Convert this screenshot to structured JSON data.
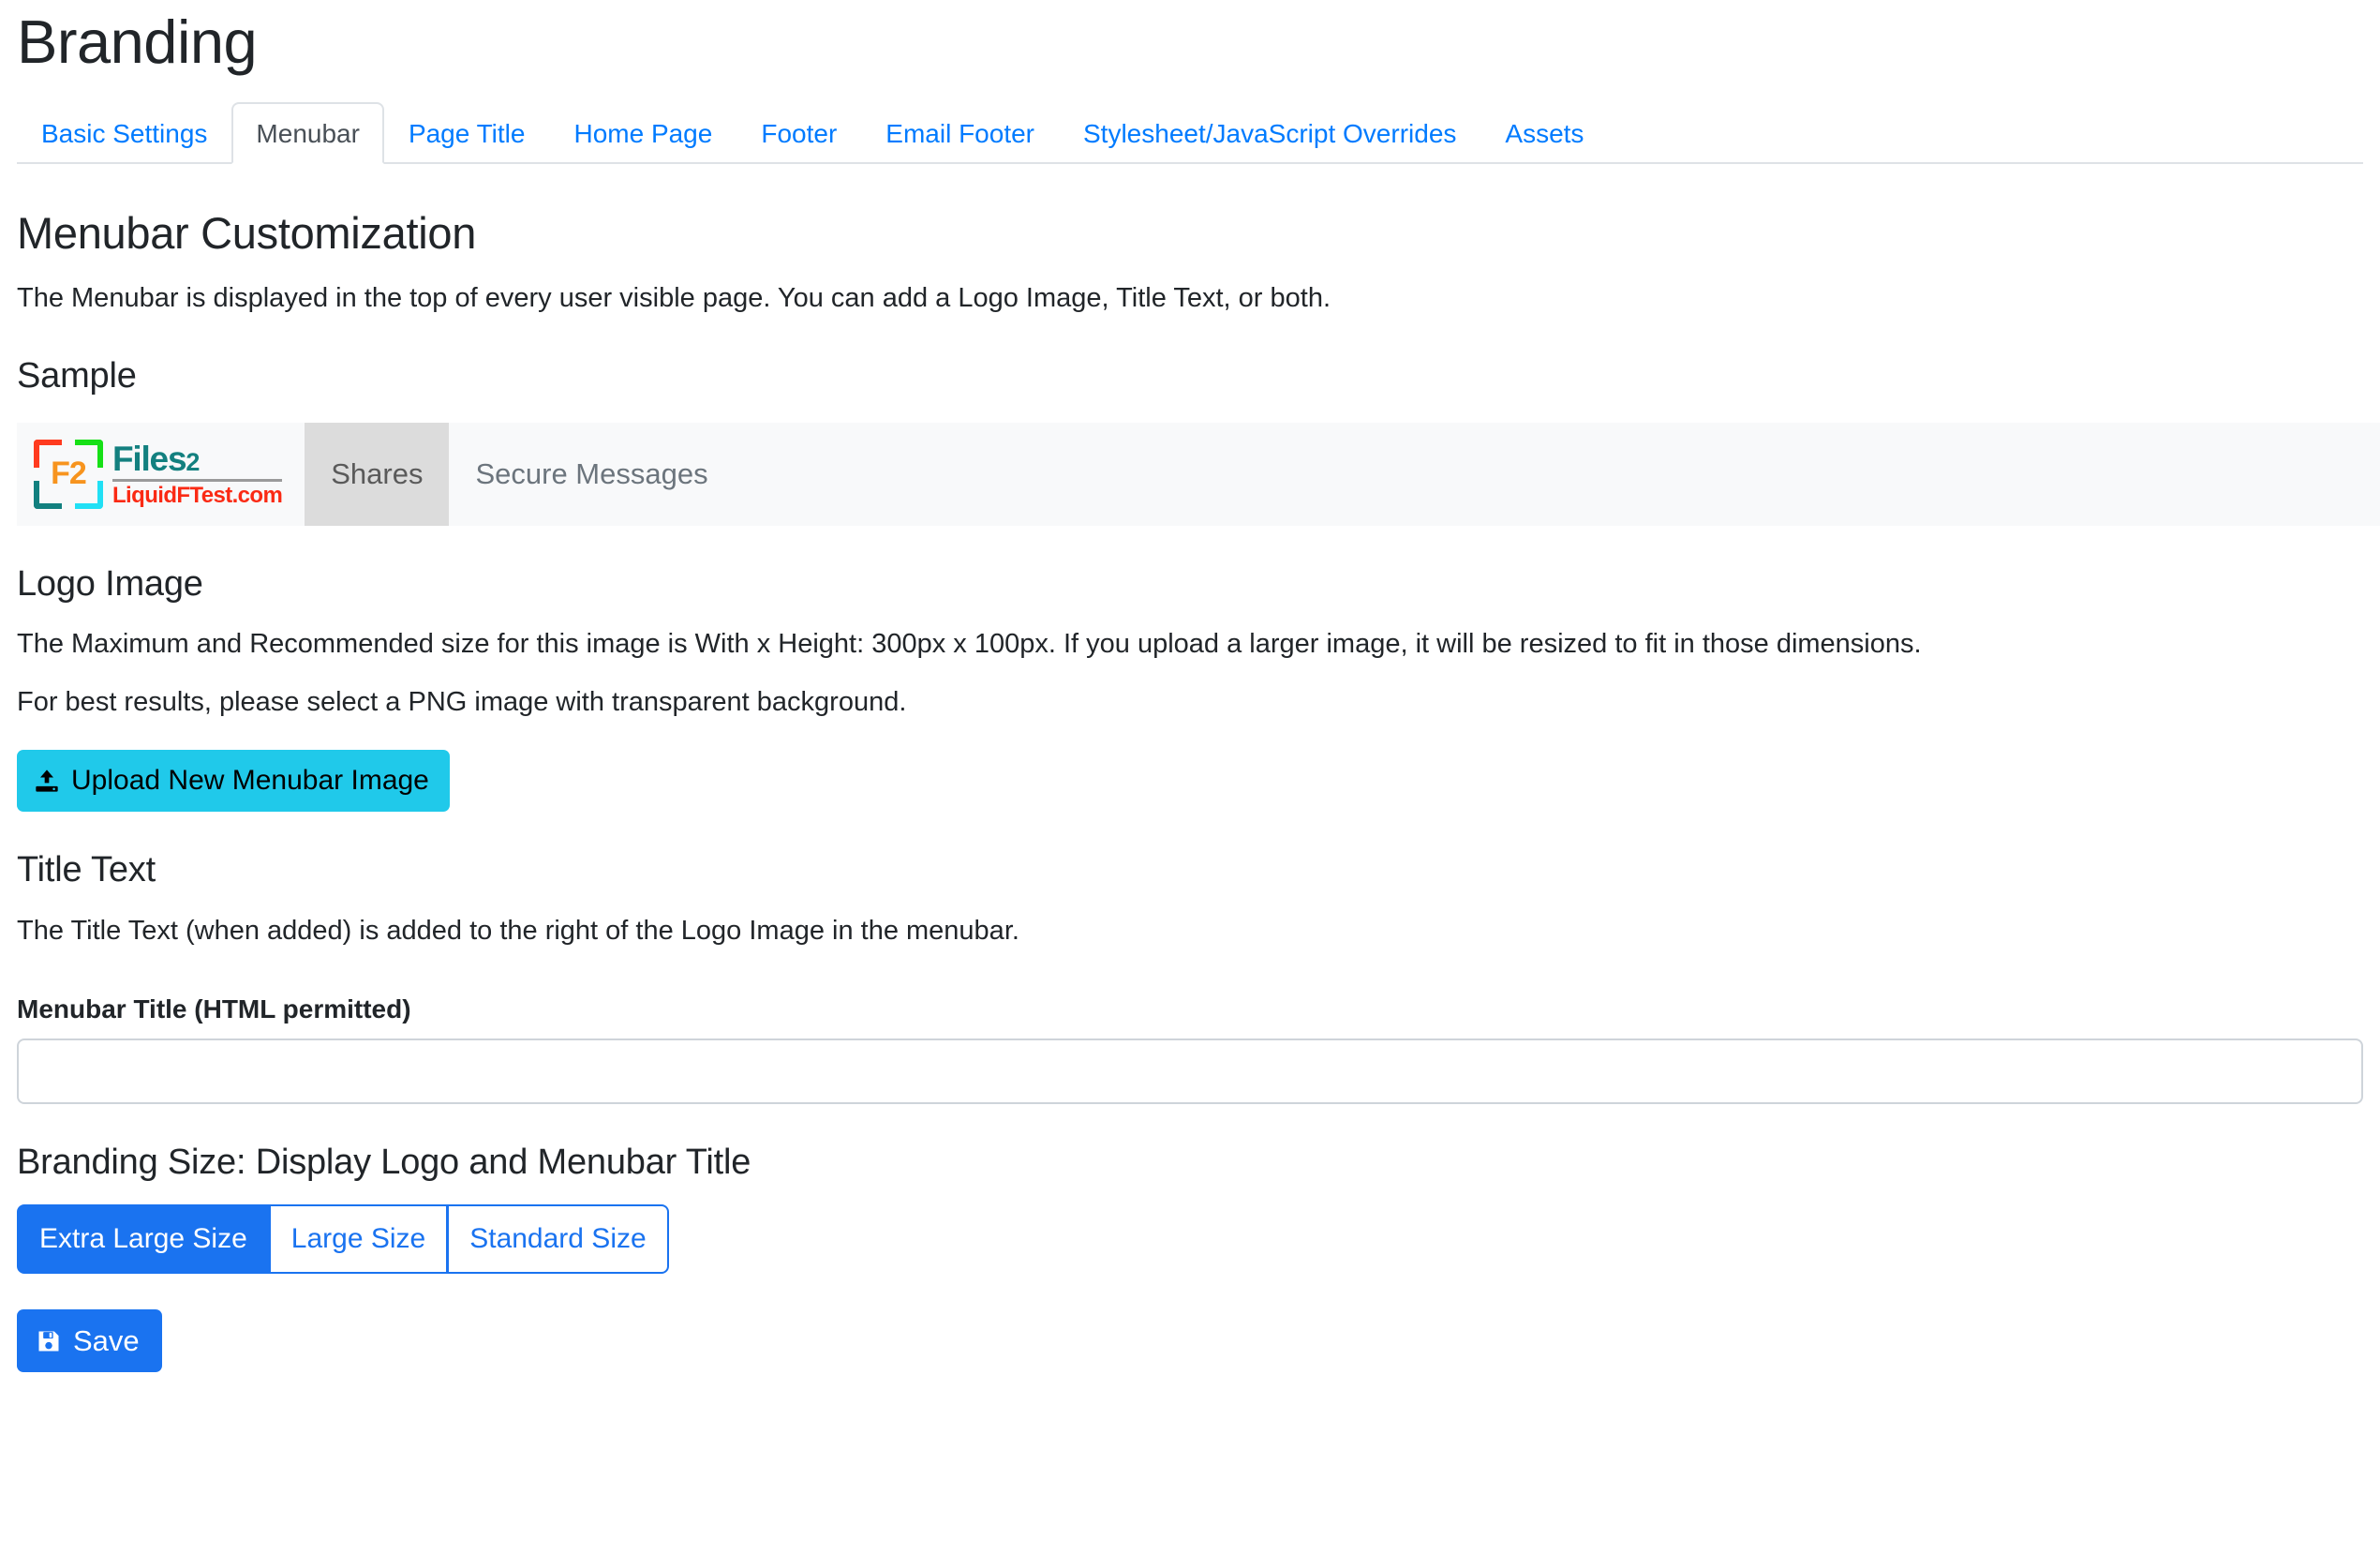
{
  "page": {
    "title": "Branding"
  },
  "tabs": [
    {
      "label": "Basic Settings",
      "active": false
    },
    {
      "label": "Menubar",
      "active": true
    },
    {
      "label": "Page Title",
      "active": false
    },
    {
      "label": "Home Page",
      "active": false
    },
    {
      "label": "Footer",
      "active": false
    },
    {
      "label": "Email Footer",
      "active": false
    },
    {
      "label": "Stylesheet/JavaScript Overrides",
      "active": false
    },
    {
      "label": "Assets",
      "active": false
    }
  ],
  "menubar_section": {
    "heading": "Menubar Customization",
    "description": "The Menubar is displayed in the top of every user visible page. You can add a Logo Image, Title Text, or both."
  },
  "sample": {
    "heading": "Sample",
    "logo": {
      "mark_text": "F2",
      "brand_name": "Files",
      "brand_suffix": "2",
      "domain": "LiquidFTest.com",
      "mark_colors": {
        "top_left": "#ff3b1f",
        "top_right": "#16e016",
        "bottom_left": "#12807f",
        "bottom_right": "#21e0f5",
        "f2_text": "#f7941e"
      },
      "brand_color": "#13807f",
      "domain_color": "#fa2a14"
    },
    "menu_items": [
      {
        "label": "Shares",
        "active": true
      },
      {
        "label": "Secure Messages",
        "active": false
      }
    ],
    "bar_background": "#f8f9fa",
    "active_item_background": "#dcdcdc"
  },
  "logo_image": {
    "heading": "Logo Image",
    "paragraph_1": "The Maximum and Recommended size for this image is With x Height: 300px x 100px. If you upload a larger image, it will be resized to fit in those dimensions.",
    "paragraph_2": "For best results, please select a PNG image with transparent background.",
    "upload_button_label": "Upload New Menubar Image",
    "upload_button_color": "#20c9ea"
  },
  "title_text": {
    "heading": "Title Text",
    "paragraph": "The Title Text (when added) is added to the right of the Logo Image in the menubar.",
    "field_label": "Menubar Title (HTML permitted)",
    "field_value": "",
    "field_placeholder": ""
  },
  "branding_size": {
    "heading": "Branding Size: Display Logo and Menubar Title",
    "options": [
      {
        "label": "Extra Large Size",
        "selected": true
      },
      {
        "label": "Large Size",
        "selected": false
      },
      {
        "label": "Standard Size",
        "selected": false
      }
    ],
    "accent_color": "#1a73f0"
  },
  "save": {
    "label": "Save",
    "color": "#1a73f0"
  }
}
